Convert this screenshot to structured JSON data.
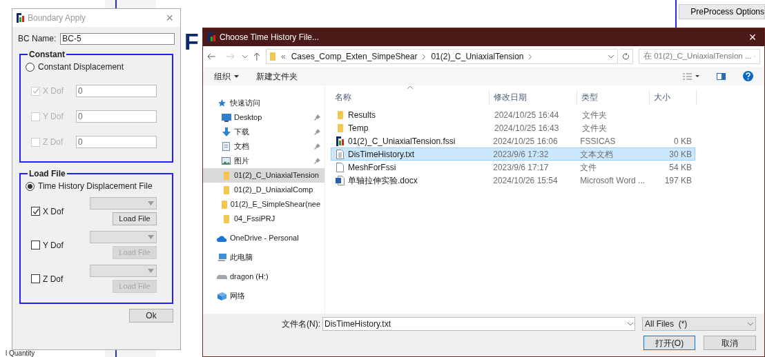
{
  "background": {
    "logo": "F",
    "panel_title": "PreProcess Options",
    "bottom_label": "l Quantity"
  },
  "boundary_dialog": {
    "title": "Boundary Apply",
    "close": "×",
    "bc_name": {
      "label": "BC Name:",
      "value": "BC-5"
    },
    "constant_group": {
      "title": "Constant",
      "option": {
        "label": "Constant Displacement",
        "selected": false
      },
      "dofs": [
        {
          "label": "X Dof",
          "checked": true,
          "disabled": true,
          "value": "0"
        },
        {
          "label": "Y Dof",
          "checked": false,
          "disabled": true,
          "value": "0"
        },
        {
          "label": "Z Dof",
          "checked": false,
          "disabled": true,
          "value": "0"
        }
      ]
    },
    "load_file_group": {
      "title": "Load File",
      "option": {
        "label": "Time History Displacement File",
        "selected": true
      },
      "dofs": [
        {
          "label": "X Dof",
          "checked": true,
          "button": "Load File",
          "disabled": false
        },
        {
          "label": "Y Dof",
          "checked": false,
          "button": "Load File",
          "disabled": true
        },
        {
          "label": "Z Dof",
          "checked": false,
          "button": "Load File",
          "disabled": true
        }
      ]
    },
    "ok_button": "Ok"
  },
  "file_dialog": {
    "title": "Choose Time History File...",
    "close": "×",
    "address": {
      "overflow_mark": "«",
      "crumbs": [
        "Cases_Comp_Exten_SimpeShear",
        "01(2)_C_UniaxialTension"
      ]
    },
    "search": {
      "placeholder": "在 01(2)_C_UniaxialTension ..."
    },
    "toolbar": {
      "organize": "组织",
      "new_folder": "新建文件夹"
    },
    "nav": [
      {
        "label": "快速访问",
        "kind": "star",
        "selected": false,
        "children": [
          {
            "label": "Desktop",
            "kind": "desktop",
            "pinned": true,
            "selected": false
          },
          {
            "label": "下载",
            "kind": "download",
            "pinned": true,
            "selected": false
          },
          {
            "label": "文档",
            "kind": "documents",
            "pinned": true,
            "selected": false
          },
          {
            "label": "图片",
            "kind": "pictures",
            "pinned": true,
            "selected": false
          },
          {
            "label": "01(2)_C_UniaxialTension",
            "kind": "folder",
            "pinned": false,
            "selected": true
          },
          {
            "label": "01(2)_D_UniaxialComp",
            "kind": "folder",
            "pinned": false,
            "selected": false
          },
          {
            "label": "01(2)_E_SimpleShear(nee",
            "kind": "folder",
            "pinned": false,
            "selected": false
          },
          {
            "label": "04_FssiPRJ",
            "kind": "folder",
            "pinned": false,
            "selected": false
          }
        ]
      },
      {
        "label": "OneDrive - Personal",
        "kind": "cloud",
        "selected": false
      },
      {
        "label": "此电脑",
        "kind": "computer",
        "selected": false
      },
      {
        "label": "dragon (H:)",
        "kind": "drive",
        "selected": false
      },
      {
        "label": "网络",
        "kind": "network",
        "selected": false
      }
    ],
    "columns": [
      "名称",
      "修改日期",
      "类型",
      "大小"
    ],
    "files": [
      {
        "name": "Results",
        "date": "2024/10/25 16:44",
        "type": "文件夹",
        "kind": "folder",
        "selected": false
      },
      {
        "name": "Temp",
        "date": "2024/10/25 16:43",
        "type": "文件夹",
        "kind": "folder",
        "selected": false
      },
      {
        "name": "01(2)_C_UniaxialTension.fssi",
        "date": "2024/10/25 16:06",
        "type": "FSSICAS",
        "size": "0 KB",
        "kind": "fssi",
        "selected": false
      },
      {
        "name": "DisTimeHistory.txt",
        "date": "2023/9/6 17:32",
        "type": "文本文档",
        "size": "30 KB",
        "kind": "text",
        "selected": true
      },
      {
        "name": "MeshForFssi",
        "date": "2023/9/6 17:17",
        "type": "文件",
        "size": "54 KB",
        "kind": "file",
        "selected": false
      },
      {
        "name": "单轴拉伸实验.docx",
        "date": "2024/10/26 15:54",
        "type": "Microsoft Word ...",
        "size": "197 KB",
        "kind": "word",
        "selected": false
      }
    ],
    "filename": {
      "label": "文件名(N):",
      "value": "DisTimeHistory.txt"
    },
    "filter": "All Files  (*)",
    "open_button": "打开(O)",
    "cancel_button": "取消"
  }
}
